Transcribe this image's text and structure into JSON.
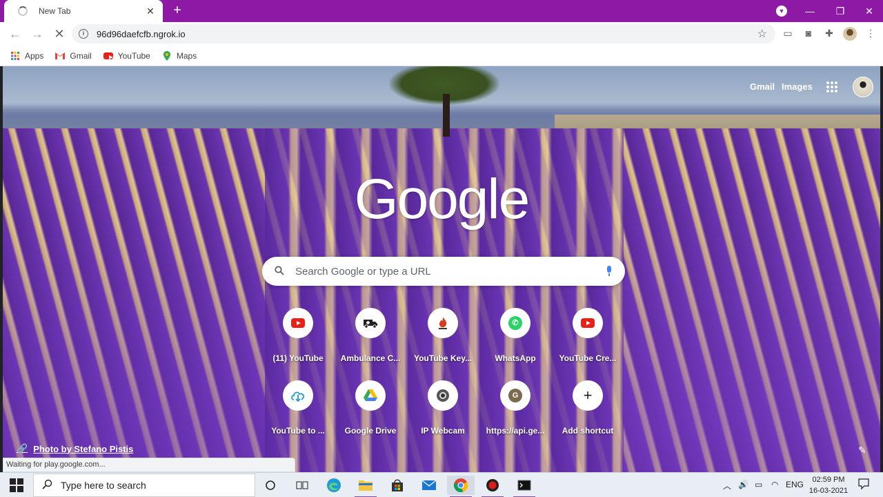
{
  "browser": {
    "tab_title": "New Tab",
    "tab_close": "✕",
    "new_tab": "+",
    "window_controls": {
      "minimize": "—",
      "maximize": "❐",
      "close": "✕"
    },
    "url": "96d96daefcfb.ngrok.io"
  },
  "bookmarks": [
    {
      "label": "Apps",
      "icon": "apps-grid-icon"
    },
    {
      "label": "Gmail",
      "icon": "gmail-icon"
    },
    {
      "label": "YouTube",
      "icon": "youtube-icon"
    },
    {
      "label": "Maps",
      "icon": "maps-pin-icon"
    }
  ],
  "ntp": {
    "top_links": {
      "gmail": "Gmail",
      "images": "Images"
    },
    "logo": "Google",
    "search_placeholder": "Search Google or type a URL",
    "shortcuts_row1": [
      {
        "label": "(11) YouTube",
        "icon": "youtube-icon"
      },
      {
        "label": "Ambulance C...",
        "icon": "ambulance-icon"
      },
      {
        "label": "YouTube Key...",
        "icon": "flame-icon"
      },
      {
        "label": "WhatsApp",
        "icon": "whatsapp-icon"
      },
      {
        "label": "YouTube Cre...",
        "icon": "youtube-icon"
      }
    ],
    "shortcuts_row2": [
      {
        "label": "YouTube to ...",
        "icon": "cloud-download-icon"
      },
      {
        "label": "Google Drive",
        "icon": "drive-icon"
      },
      {
        "label": "IP Webcam",
        "icon": "webcam-icon"
      },
      {
        "label": "https://api.ge...",
        "icon": "letter-g-icon",
        "letter": "G"
      },
      {
        "label": "Add shortcut",
        "icon": "plus-icon"
      }
    ],
    "photo_credit": "Photo by Stefano Pistis",
    "status_text": "Waiting for play.google.com..."
  },
  "taskbar": {
    "search_placeholder": "Type here to search",
    "language": "ENG",
    "time": "02:59 PM",
    "date": "16-03-2021"
  },
  "colors": {
    "titlebar": "#8e19a4",
    "lavender": "#5b2b9a"
  }
}
